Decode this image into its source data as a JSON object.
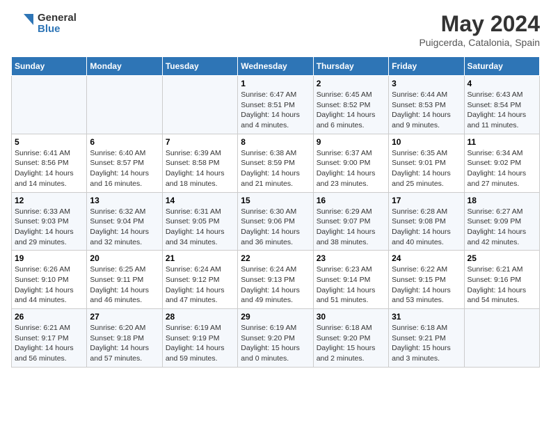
{
  "logo": {
    "line1": "General",
    "line2": "Blue"
  },
  "title": "May 2024",
  "location": "Puigcerda, Catalonia, Spain",
  "days_of_week": [
    "Sunday",
    "Monday",
    "Tuesday",
    "Wednesday",
    "Thursday",
    "Friday",
    "Saturday"
  ],
  "weeks": [
    [
      {
        "day": "",
        "info": ""
      },
      {
        "day": "",
        "info": ""
      },
      {
        "day": "",
        "info": ""
      },
      {
        "day": "1",
        "info": "Sunrise: 6:47 AM\nSunset: 8:51 PM\nDaylight: 14 hours\nand 4 minutes."
      },
      {
        "day": "2",
        "info": "Sunrise: 6:45 AM\nSunset: 8:52 PM\nDaylight: 14 hours\nand 6 minutes."
      },
      {
        "day": "3",
        "info": "Sunrise: 6:44 AM\nSunset: 8:53 PM\nDaylight: 14 hours\nand 9 minutes."
      },
      {
        "day": "4",
        "info": "Sunrise: 6:43 AM\nSunset: 8:54 PM\nDaylight: 14 hours\nand 11 minutes."
      }
    ],
    [
      {
        "day": "5",
        "info": "Sunrise: 6:41 AM\nSunset: 8:56 PM\nDaylight: 14 hours\nand 14 minutes."
      },
      {
        "day": "6",
        "info": "Sunrise: 6:40 AM\nSunset: 8:57 PM\nDaylight: 14 hours\nand 16 minutes."
      },
      {
        "day": "7",
        "info": "Sunrise: 6:39 AM\nSunset: 8:58 PM\nDaylight: 14 hours\nand 18 minutes."
      },
      {
        "day": "8",
        "info": "Sunrise: 6:38 AM\nSunset: 8:59 PM\nDaylight: 14 hours\nand 21 minutes."
      },
      {
        "day": "9",
        "info": "Sunrise: 6:37 AM\nSunset: 9:00 PM\nDaylight: 14 hours\nand 23 minutes."
      },
      {
        "day": "10",
        "info": "Sunrise: 6:35 AM\nSunset: 9:01 PM\nDaylight: 14 hours\nand 25 minutes."
      },
      {
        "day": "11",
        "info": "Sunrise: 6:34 AM\nSunset: 9:02 PM\nDaylight: 14 hours\nand 27 minutes."
      }
    ],
    [
      {
        "day": "12",
        "info": "Sunrise: 6:33 AM\nSunset: 9:03 PM\nDaylight: 14 hours\nand 29 minutes."
      },
      {
        "day": "13",
        "info": "Sunrise: 6:32 AM\nSunset: 9:04 PM\nDaylight: 14 hours\nand 32 minutes."
      },
      {
        "day": "14",
        "info": "Sunrise: 6:31 AM\nSunset: 9:05 PM\nDaylight: 14 hours\nand 34 minutes."
      },
      {
        "day": "15",
        "info": "Sunrise: 6:30 AM\nSunset: 9:06 PM\nDaylight: 14 hours\nand 36 minutes."
      },
      {
        "day": "16",
        "info": "Sunrise: 6:29 AM\nSunset: 9:07 PM\nDaylight: 14 hours\nand 38 minutes."
      },
      {
        "day": "17",
        "info": "Sunrise: 6:28 AM\nSunset: 9:08 PM\nDaylight: 14 hours\nand 40 minutes."
      },
      {
        "day": "18",
        "info": "Sunrise: 6:27 AM\nSunset: 9:09 PM\nDaylight: 14 hours\nand 42 minutes."
      }
    ],
    [
      {
        "day": "19",
        "info": "Sunrise: 6:26 AM\nSunset: 9:10 PM\nDaylight: 14 hours\nand 44 minutes."
      },
      {
        "day": "20",
        "info": "Sunrise: 6:25 AM\nSunset: 9:11 PM\nDaylight: 14 hours\nand 46 minutes."
      },
      {
        "day": "21",
        "info": "Sunrise: 6:24 AM\nSunset: 9:12 PM\nDaylight: 14 hours\nand 47 minutes."
      },
      {
        "day": "22",
        "info": "Sunrise: 6:24 AM\nSunset: 9:13 PM\nDaylight: 14 hours\nand 49 minutes."
      },
      {
        "day": "23",
        "info": "Sunrise: 6:23 AM\nSunset: 9:14 PM\nDaylight: 14 hours\nand 51 minutes."
      },
      {
        "day": "24",
        "info": "Sunrise: 6:22 AM\nSunset: 9:15 PM\nDaylight: 14 hours\nand 53 minutes."
      },
      {
        "day": "25",
        "info": "Sunrise: 6:21 AM\nSunset: 9:16 PM\nDaylight: 14 hours\nand 54 minutes."
      }
    ],
    [
      {
        "day": "26",
        "info": "Sunrise: 6:21 AM\nSunset: 9:17 PM\nDaylight: 14 hours\nand 56 minutes."
      },
      {
        "day": "27",
        "info": "Sunrise: 6:20 AM\nSunset: 9:18 PM\nDaylight: 14 hours\nand 57 minutes."
      },
      {
        "day": "28",
        "info": "Sunrise: 6:19 AM\nSunset: 9:19 PM\nDaylight: 14 hours\nand 59 minutes."
      },
      {
        "day": "29",
        "info": "Sunrise: 6:19 AM\nSunset: 9:20 PM\nDaylight: 15 hours\nand 0 minutes."
      },
      {
        "day": "30",
        "info": "Sunrise: 6:18 AM\nSunset: 9:20 PM\nDaylight: 15 hours\nand 2 minutes."
      },
      {
        "day": "31",
        "info": "Sunrise: 6:18 AM\nSunset: 9:21 PM\nDaylight: 15 hours\nand 3 minutes."
      },
      {
        "day": "",
        "info": ""
      }
    ]
  ]
}
